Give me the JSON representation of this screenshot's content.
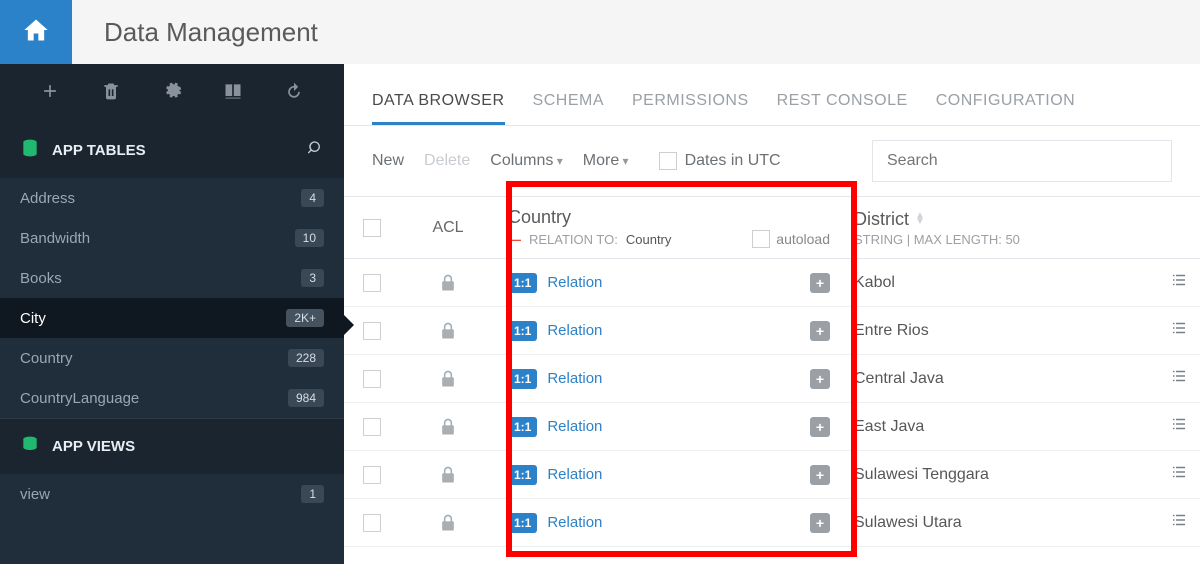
{
  "header": {
    "title": "Data Management"
  },
  "sidebar": {
    "tables_heading": "APP TABLES",
    "views_heading": "APP VIEWS",
    "tables": [
      {
        "name": "Address",
        "count": "4",
        "active": false
      },
      {
        "name": "Bandwidth",
        "count": "10",
        "active": false
      },
      {
        "name": "Books",
        "count": "3",
        "active": false
      },
      {
        "name": "City",
        "count": "2K+",
        "active": true
      },
      {
        "name": "Country",
        "count": "228",
        "active": false
      },
      {
        "name": "CountryLanguage",
        "count": "984",
        "active": false
      }
    ],
    "views": [
      {
        "name": "view",
        "count": "1"
      }
    ]
  },
  "tabs": [
    {
      "label": "DATA BROWSER",
      "active": true
    },
    {
      "label": "SCHEMA",
      "active": false
    },
    {
      "label": "PERMISSIONS",
      "active": false
    },
    {
      "label": "REST CONSOLE",
      "active": false
    },
    {
      "label": "CONFIGURATION",
      "active": false
    }
  ],
  "toolbar": {
    "new": "New",
    "delete": "Delete",
    "columns": "Columns",
    "more": "More",
    "dates_utc": "Dates in UTC",
    "search_placeholder": "Search"
  },
  "columns": {
    "acl": "ACL",
    "country": {
      "title": "Country",
      "relation_label": "RELATION TO:",
      "relation_target": "Country",
      "autoload": "autoload"
    },
    "district": {
      "title": "District",
      "meta": "STRING | MAX LENGTH: 50"
    }
  },
  "relation_badge": "1:1",
  "relation_text": "Relation",
  "rows": [
    {
      "district": "Kabol"
    },
    {
      "district": "Entre Rios"
    },
    {
      "district": "Central Java"
    },
    {
      "district": "East Java"
    },
    {
      "district": "Sulawesi Tenggara"
    },
    {
      "district": "Sulawesi Utara"
    }
  ]
}
